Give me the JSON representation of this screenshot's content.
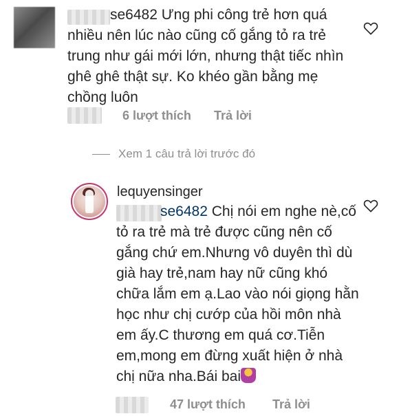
{
  "comment1": {
    "username_suffix": "se6482",
    "text": "Ưng phi công trẻ hơn quá nhiều nên lúc nào cũng cố gắng tỏ ra trẻ trung như gái mới lớn, nhưng thật tiếc nhìn ghê ghê thật sự. Ko khéo gần bằng mẹ chồng luôn",
    "likes": "6 lượt thích",
    "reply": "Trả lời"
  },
  "view_replies": "Xem 1 câu trả lời trước đó",
  "reply1": {
    "username": "lequyensinger",
    "mention_suffix": "se6482",
    "text": "Chị nói em nghe nè,cố tỏ ra trẻ mà trẻ được cũng nên cố gắng chứ em.Nhưng vô duyên thì dù già hay trẻ,nam hay nữ cũng khó chữa lắm em ạ.Lao vào nói giọng hằn học như chị cướp của hồi môn nhà em ấy.C thương em quá cơ.Tiễn em,mong em đừng xuất hiện ở nhà chị nữa nha.Bái bai",
    "emoji": "woman-shrugging-emoji",
    "likes": "47 lượt thích",
    "reply": "Trả lời"
  },
  "colors": {
    "text": "#262626",
    "meta": "#8e8e8e",
    "mention": "#003569",
    "story_ring": "#c7356f"
  }
}
